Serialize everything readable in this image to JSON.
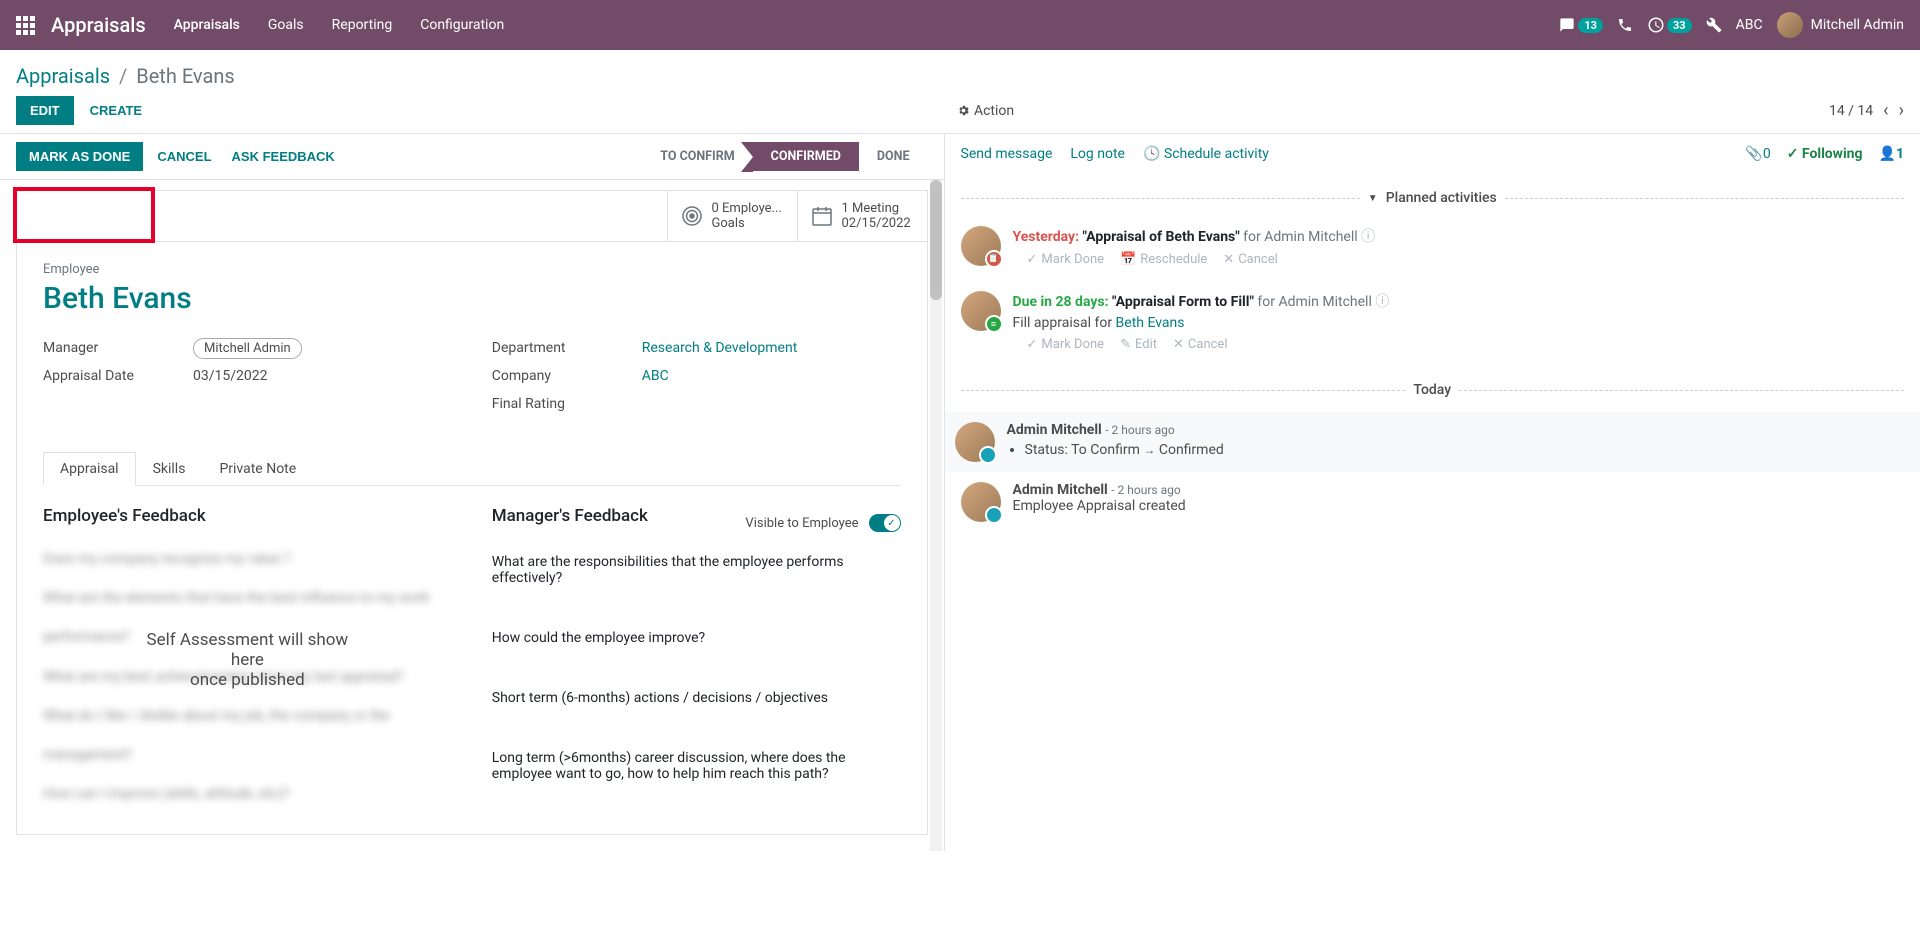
{
  "topbar": {
    "app_title": "Appraisals",
    "nav": [
      "Appraisals",
      "Goals",
      "Reporting",
      "Configuration"
    ],
    "msg_badge": "13",
    "clock_badge": "33",
    "company": "ABC",
    "user_name": "Mitchell Admin"
  },
  "breadcrumb": {
    "root": "Appraisals",
    "current": "Beth Evans"
  },
  "buttons": {
    "edit": "EDIT",
    "create": "CREATE",
    "action": "Action"
  },
  "pager": {
    "text": "14 / 14"
  },
  "statusbar": {
    "mark_done": "MARK AS DONE",
    "cancel": "CANCEL",
    "ask_feedback": "ASK FEEDBACK",
    "stages": [
      "TO CONFIRM",
      "CONFIRMED",
      "DONE"
    ]
  },
  "statbtns": {
    "goals_line1": "0 Employe...",
    "goals_line2": "Goals",
    "meeting_line1": "1 Meeting",
    "meeting_line2": "02/15/2022"
  },
  "record": {
    "emp_label": "Employee",
    "emp_name": "Beth Evans",
    "fields": {
      "manager_label": "Manager",
      "manager_value": "Mitchell Admin",
      "date_label": "Appraisal Date",
      "date_value": "03/15/2022",
      "dept_label": "Department",
      "dept_value": "Research & Development",
      "company_label": "Company",
      "company_value": "ABC",
      "rating_label": "Final Rating"
    }
  },
  "tabs": [
    "Appraisal",
    "Skills",
    "Private Note"
  ],
  "feedback": {
    "emp_title": "Employee's Feedback",
    "emp_overlay_l1": "Self Assessment will show here",
    "emp_overlay_l2": "once published",
    "blur_lines": [
      "Does my company recognize my value ?",
      "What are the elements that have the best influence to my work performance?",
      "What are my best achievement(s) since my last appraisal?",
      "What do I like / dislike about my job, the company or the management?",
      "How can I improve (skills, attitude, etc)?"
    ],
    "mgr_title": "Manager's Feedback",
    "visible_label": "Visible to Employee",
    "mgr_q1": "What are the responsibilities that the employee performs effectively?",
    "mgr_q2": "How could the employee improve?",
    "mgr_q3": "Short term (6-months) actions / decisions / objectives",
    "mgr_q4": "Long term (>6months) career discussion, where does the employee want to go, how to help him reach this path?"
  },
  "chatter": {
    "send": "Send message",
    "log": "Log note",
    "schedule": "Schedule activity",
    "attach_count": "0",
    "following": "Following",
    "followers": "1",
    "planned_title": "Planned activities",
    "act1": {
      "due": "Yesterday:",
      "title": "\"Appraisal of Beth Evans\"",
      "for": "for Admin Mitchell"
    },
    "act2": {
      "due": "Due in 28 days:",
      "title": "\"Appraisal Form to Fill\"",
      "for": "for Admin Mitchell",
      "body_prefix": "Fill appraisal for ",
      "body_link": "Beth Evans"
    },
    "act_btns": {
      "mark_done": "Mark Done",
      "reschedule": "Reschedule",
      "edit": "Edit",
      "cancel": "Cancel"
    },
    "today_title": "Today",
    "msg1": {
      "author": "Admin Mitchell",
      "time": "- 2 hours ago",
      "status_prefix": "Status: ",
      "status_from": "To Confirm",
      "status_to": "Confirmed"
    },
    "msg2": {
      "author": "Admin Mitchell",
      "time": "- 2 hours ago",
      "body": "Employee Appraisal created"
    }
  }
}
